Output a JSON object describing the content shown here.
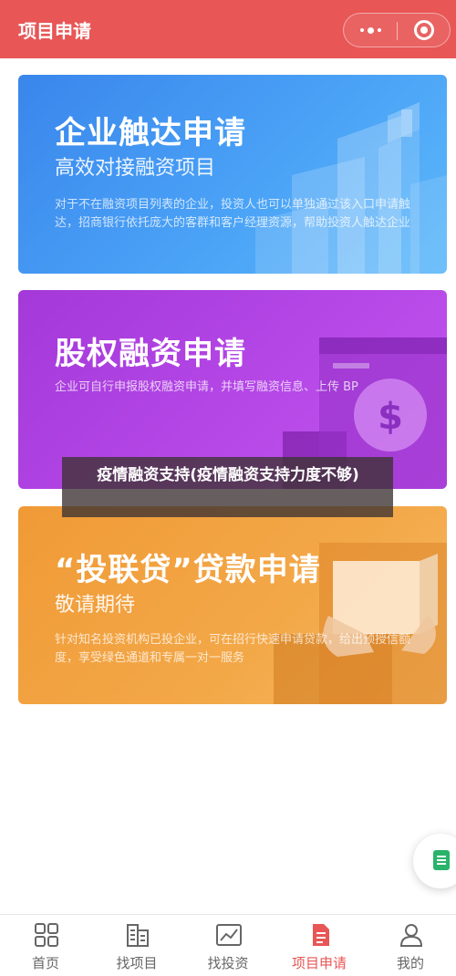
{
  "header": {
    "title": "项目申请",
    "background": "#e85656",
    "more_icon": "more-dots-icon",
    "close_icon": "target-close-icon"
  },
  "cards": [
    {
      "title": "企业触达申请",
      "subtitle": "高效对接融资项目",
      "description": "对于不在融资项目列表的企业，投资人也可以单独通过该入口申请触达，招商银行依托庞大的客群和客户经理资源，帮助投资人触达企业",
      "color": "#3a86ec"
    },
    {
      "title": "股权融资申请",
      "description": "企业可自行申报股权融资申请，并填写融资信息、上传 BP",
      "color": "#a438d8",
      "illustration_glyph": "$"
    },
    {
      "title": "“投联贷”贷款申请",
      "subtitle": "敬请期待",
      "description": "针对知名投资机构已投企业，可在招行快速申请贷款，给出预授信额度，享受绿色通道和专属一对一服务",
      "color": "#f09a36"
    }
  ],
  "overlay": {
    "text": "疫情融资支持(疫情融资支持力度不够)"
  },
  "float_button": {
    "icon": "document-list-icon",
    "color": "#29b36c"
  },
  "tabbar": {
    "active_color": "#e85656",
    "items": [
      {
        "label": "首页",
        "icon": "home-grid-icon",
        "active": false
      },
      {
        "label": "找项目",
        "icon": "building-icon",
        "active": false
      },
      {
        "label": "找投资",
        "icon": "trend-chart-icon",
        "active": false
      },
      {
        "label": "项目申请",
        "icon": "document-icon",
        "active": true
      },
      {
        "label": "我的",
        "icon": "user-icon",
        "active": false
      }
    ]
  }
}
